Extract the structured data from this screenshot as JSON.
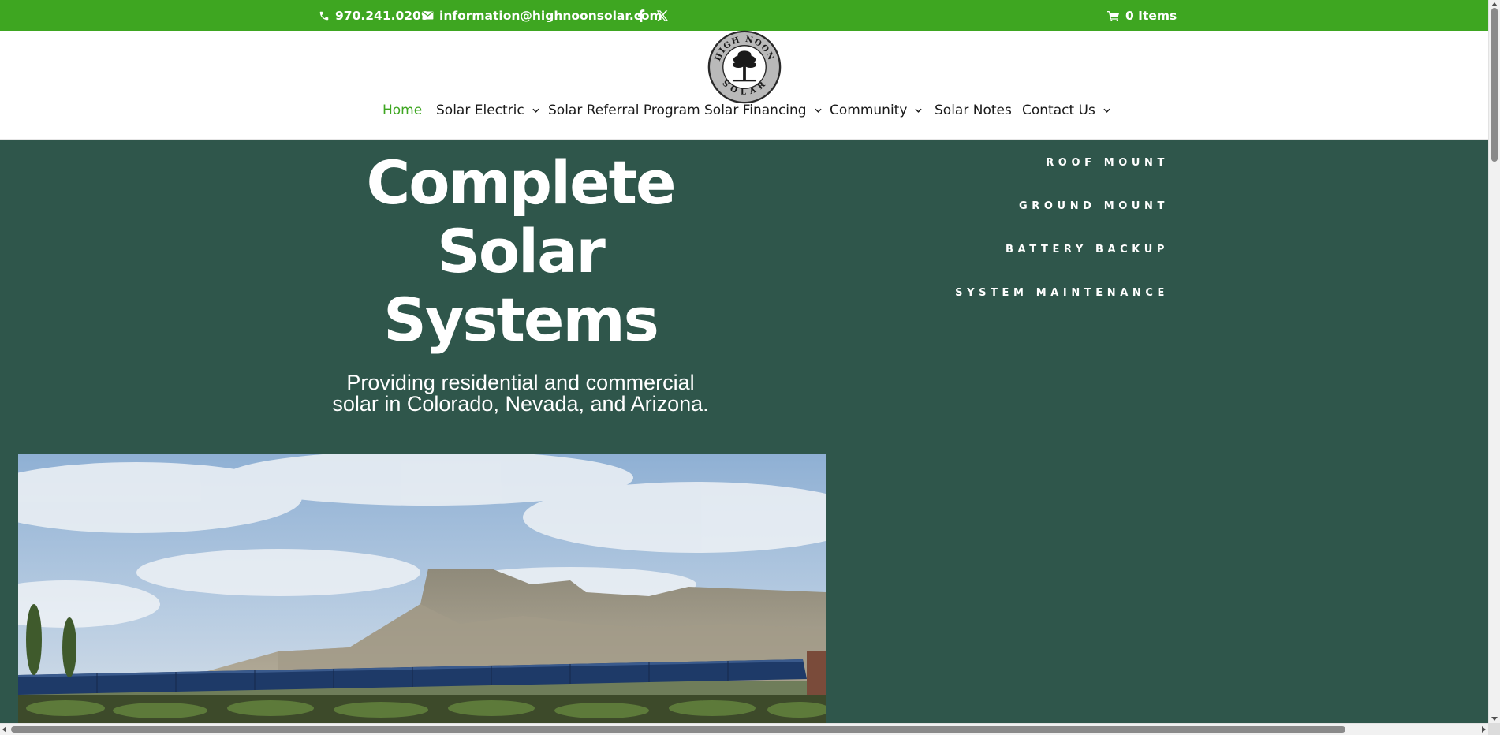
{
  "topbar": {
    "phone": "970.241.0209",
    "email": "information@highnoonsolar.com",
    "cart": "0 Items",
    "icons": [
      "phone-icon",
      "email-icon",
      "facebook-icon",
      "x-twitter-icon",
      "cart-icon"
    ]
  },
  "logo": {
    "top_text": "HIGH NOON",
    "bottom_text": "SOLAR"
  },
  "nav": {
    "items": [
      {
        "label": "Home",
        "active": true,
        "dropdown": false
      },
      {
        "label": "Solar Electric",
        "active": false,
        "dropdown": true
      },
      {
        "label": "Solar Referral Program",
        "active": false,
        "dropdown": false
      },
      {
        "label": "Solar Financing",
        "active": false,
        "dropdown": true
      },
      {
        "label": "Community",
        "active": false,
        "dropdown": true
      },
      {
        "label": "Solar Notes",
        "active": false,
        "dropdown": false
      },
      {
        "label": "Contact Us",
        "active": false,
        "dropdown": true
      }
    ]
  },
  "hero": {
    "title_lines": [
      "Complete",
      "Solar",
      "Systems"
    ],
    "subtitle_lines": [
      "Providing residential and commercial",
      "solar in Colorado, Nevada, and Arizona."
    ],
    "side_links": [
      "ROOF MOUNT",
      "GROUND MOUNT",
      "BATTERY BACKUP",
      "SYSTEM MAINTENANCE"
    ]
  },
  "colors": {
    "topbar": "#3ea621",
    "hero_bg": "#2f564b",
    "nav_active": "#3ea621",
    "nav_text": "#1a1a1a"
  }
}
